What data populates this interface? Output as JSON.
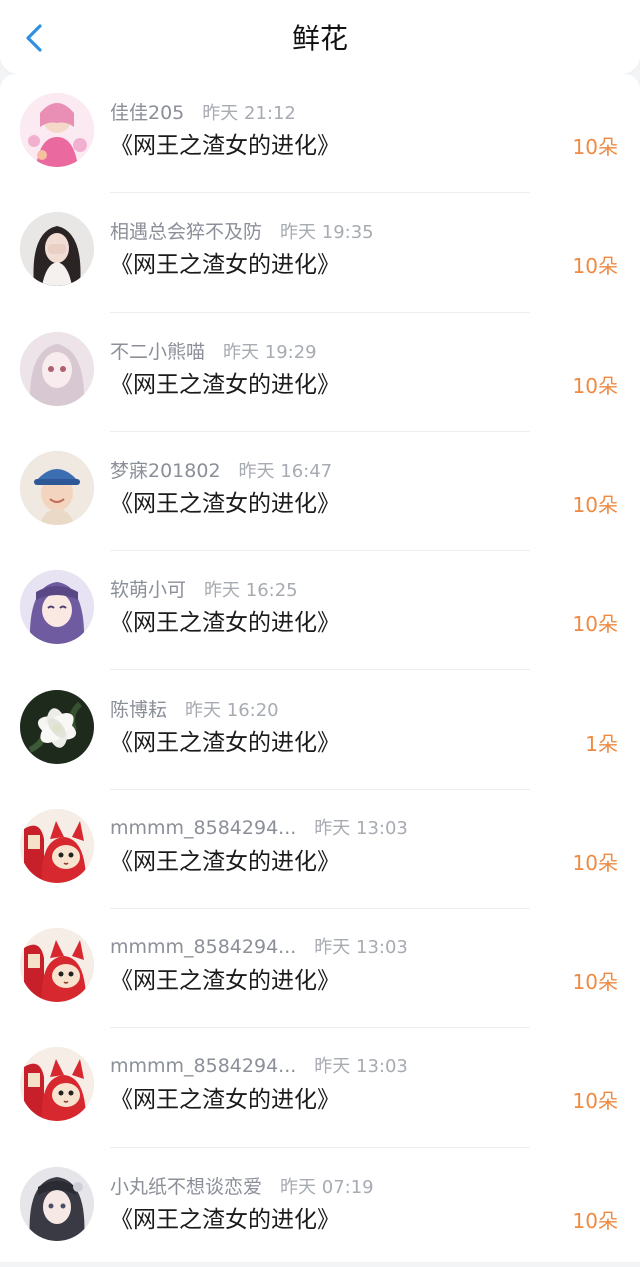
{
  "header": {
    "title": "鲜花",
    "back_icon": "chevron-left-icon"
  },
  "colors": {
    "accent": "#2f8fe0",
    "count": "#ee8a43"
  },
  "list": [
    {
      "name": "佳佳205",
      "time": "昨天 21:12",
      "book": "《网王之渣女的进化》",
      "count": "10朵",
      "avatar": "anime-girl-pink"
    },
    {
      "name": "相遇总会猝不及防",
      "time": "昨天 19:35",
      "book": "《网王之渣女的进化》",
      "count": "10朵",
      "avatar": "girl-dark-hair"
    },
    {
      "name": "不二小熊喵",
      "time": "昨天 19:29",
      "book": "《网王之渣女的进化》",
      "count": "10朵",
      "avatar": "anime-girl-pale"
    },
    {
      "name": "梦寐201802",
      "time": "昨天 16:47",
      "book": "《网王之渣女的进化》",
      "count": "10朵",
      "avatar": "boy-cap"
    },
    {
      "name": "软萌小可",
      "time": "昨天 16:25",
      "book": "《网王之渣女的进化》",
      "count": "10朵",
      "avatar": "anime-girl-purple"
    },
    {
      "name": "陈博耘",
      "time": "昨天 16:20",
      "book": "《网王之渣女的进化》",
      "count": "1朵",
      "avatar": "white-flower"
    },
    {
      "name": "mmmm_8584294...",
      "time": "昨天 13:03",
      "book": "《网王之渣女的进化》",
      "count": "10朵",
      "avatar": "red-cat"
    },
    {
      "name": "mmmm_8584294...",
      "time": "昨天 13:03",
      "book": "《网王之渣女的进化》",
      "count": "10朵",
      "avatar": "red-cat"
    },
    {
      "name": "mmmm_8584294...",
      "time": "昨天 13:03",
      "book": "《网王之渣女的进化》",
      "count": "10朵",
      "avatar": "red-cat"
    },
    {
      "name": "小丸纸不想谈恋爱",
      "time": "昨天 07:19",
      "book": "《网王之渣女的进化》",
      "count": "10朵",
      "avatar": "anime-girl-gray"
    }
  ]
}
